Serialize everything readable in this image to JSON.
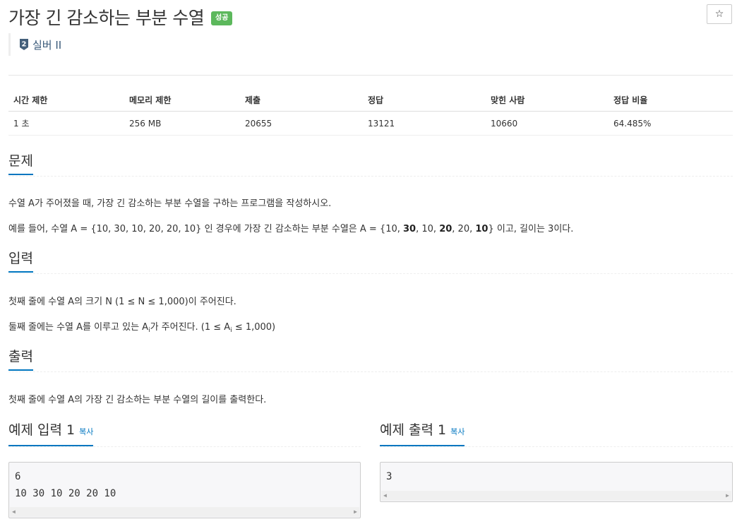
{
  "problem": {
    "title": "가장 긴 감소하는 부분 수열",
    "status_badge": "성공",
    "tier_number": "2",
    "tier_label": "실버 II",
    "star_icon": "☆"
  },
  "info_table": {
    "headers": [
      "시간 제한",
      "메모리 제한",
      "제출",
      "정답",
      "맞힌 사람",
      "정답 비율"
    ],
    "values": [
      "1 초",
      "256 MB",
      "20655",
      "13121",
      "10660",
      "64.485%"
    ]
  },
  "sections": {
    "problem_heading": "문제",
    "problem_text_1": "수열 A가 주어졌을 때, 가장 긴 감소하는 부분 수열을 구하는 프로그램을 작성하시오.",
    "problem_text_2": {
      "prefix": "예를 들어, 수열 A = {10, 30, 10, 20, 20, 10} 인 경우에 가장 긴 감소하는 부분 수열은 A = {10, ",
      "b1": "30",
      "m1": ", 10, ",
      "b2": "20",
      "m2": ", 20, ",
      "b3": "10",
      "suffix": "}  이고, 길이는 3이다."
    },
    "input_heading": "입력",
    "input_text_1": "첫째 줄에 수열 A의 크기 N (1 ≤ N ≤ 1,000)이 주어진다.",
    "input_text_2": {
      "prefix": "둘째 줄에는 수열 A를 이루고 있는 A",
      "sub": "i",
      "suffix": "가 주어진다. (1 ≤ A",
      "sub2": "i",
      "end": " ≤ 1,000)"
    },
    "output_heading": "출력",
    "output_text": "첫째 줄에 수열 A의 가장 긴 감소하는 부분 수열의 길이를 출력한다."
  },
  "samples": {
    "input_label": "예제 입력 1",
    "output_label": "예제 출력 1",
    "copy_label": "복사",
    "input_line_1": "6",
    "input_line_2": "10 30 10 20 20 10",
    "output_line_1": "3"
  },
  "colors": {
    "accent": "#0076c0",
    "success": "#5cb85c"
  }
}
